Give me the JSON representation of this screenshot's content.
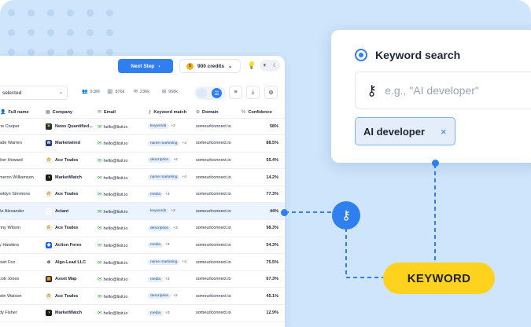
{
  "topbar": {
    "next_step_label": "Next Step",
    "next_icon": "chevron-right",
    "credits": "900 credits",
    "coin_glyph": "$",
    "theme_icons": [
      "sun-icon",
      "moon-icon"
    ]
  },
  "filters": {
    "select_value": "selected",
    "stats": [
      "9.9M",
      "876k",
      "236k",
      "968k"
    ]
  },
  "table": {
    "columns": [
      "Full name",
      "Company",
      "Email",
      "Keyword match",
      "Domain",
      "Confidence"
    ],
    "rows": [
      {
        "name": "ane Cooper",
        "company": "News Quantified...",
        "email": "hello@lisit.io",
        "keyword": "keywords",
        "more": "+2",
        "domain": "someurlconnect.io",
        "confidence": "58%"
      },
      {
        "name": "Vade Warren",
        "company": "Marketwired",
        "email": "hello@lisit.io",
        "keyword": "name marketing",
        "more": "+4",
        "domain": "someurlconnect.io",
        "confidence": "88.5%"
      },
      {
        "name": "sther Howard",
        "company": "Ace Trades",
        "email": "hello@lisit.io",
        "keyword": "description",
        "more": "+2",
        "domain": "someurlconnect.io",
        "confidence": "55.4%"
      },
      {
        "name": "ameron Williamson",
        "company": "MarketWatch",
        "email": "hello@lisit.io",
        "keyword": "name marketing",
        "more": "+4",
        "domain": "someurlconnect.io",
        "confidence": "14.2%"
      },
      {
        "name": "rooklyn Simmons",
        "company": "Ace Trades",
        "email": "hello@lisit.io",
        "keyword": "media",
        "more": "+3",
        "domain": "someurlconnect.io",
        "confidence": "77.3%"
      },
      {
        "name": "elle Alexander",
        "company": "Actant",
        "email": "hello@lisit.io",
        "keyword": "keywords",
        "more": "+2",
        "domain": "someurlconnect.io",
        "confidence": "44%"
      },
      {
        "name": "enny Wilson",
        "company": "Ace Trades",
        "email": "hello@lisit.io",
        "keyword": "description",
        "more": "+3",
        "domain": "someurlconnect.io",
        "confidence": "98.3%"
      },
      {
        "name": "uy Hawkins",
        "company": "Action Forex",
        "email": "hello@lisit.io",
        "keyword": "media",
        "more": "+3",
        "domain": "someurlconnect.io",
        "confidence": "54.3%"
      },
      {
        "name": "obert Fox",
        "company": "Algo-Lead LLC",
        "email": "hello@lisit.io",
        "keyword": "name marketing",
        "more": "+4",
        "domain": "someurlconnect.io",
        "confidence": "75.5%"
      },
      {
        "name": "acob Jones",
        "company": "Asset Map",
        "email": "hello@lisit.io",
        "keyword": "media",
        "more": "+3",
        "domain": "someurlconnect.io",
        "confidence": "67.3%"
      },
      {
        "name": "ristin Watson",
        "company": "Ace Trades",
        "email": "hello@lisit.io",
        "keyword": "description",
        "more": "+2",
        "domain": "someurlconnect.io",
        "confidence": "45.1%"
      },
      {
        "name": "ody Fisher",
        "company": "MarketWatch",
        "email": "hello@lisit.io",
        "keyword": "media",
        "more": "+3",
        "domain": "someurlconnect.io",
        "confidence": "12.9%"
      }
    ]
  },
  "keyword_card": {
    "title": "Keyword search",
    "placeholder": "e.g., \"AI developer\"",
    "chip_label": "AI developer",
    "chip_close": "×"
  },
  "keyword_pill": "KEYWORD",
  "colors": {
    "accent": "#2f7ff0",
    "background": "#cfe5fb",
    "highlight": "#ffd21e"
  }
}
